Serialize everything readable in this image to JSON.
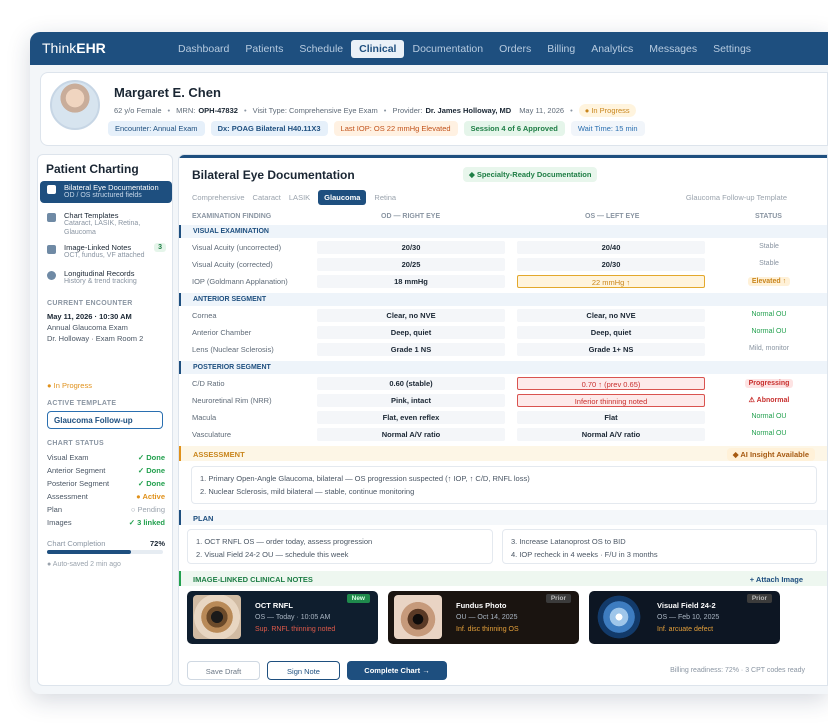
{
  "app": {
    "logo_a": "Think",
    "logo_b": "EHR"
  },
  "nav": [
    "Dashboard",
    "Patients",
    "Schedule",
    "Clinical",
    "Documentation",
    "Orders",
    "Billing",
    "Analytics",
    "Messages",
    "Settings"
  ],
  "patient": {
    "name": "Margaret E. Chen",
    "age_sex": "62 y/o Female",
    "mrn_label": "MRN:",
    "mrn": "OPH-47832",
    "visit": "Visit Type: Comprehensive Eye Exam",
    "provider_label": "Provider:",
    "provider": "Dr. James Holloway, MD",
    "date": "May 11, 2026",
    "status": "● In Progress",
    "chips": [
      "Encounter: Annual Exam",
      "Dx: POAG Bilateral H40.11X3",
      "Last IOP: OS 22 mmHg Elevated",
      "Session 4 of 6 Approved",
      "Wait Time: 15 min"
    ]
  },
  "sidebar": {
    "title": "Patient Charting",
    "items": [
      {
        "title": "Bilateral Eye Documentation",
        "sub": "OD / OS structured fields"
      },
      {
        "title": "Chart Templates",
        "sub": "Cataract, LASIK, Retina,",
        "sub2": "Glaucoma"
      },
      {
        "title": "Image-Linked Notes",
        "sub": "OCT, fundus, VF attached",
        "badge": "3"
      },
      {
        "title": "Longitudinal Records",
        "sub": "History & trend tracking"
      }
    ],
    "encounter_label": "CURRENT ENCOUNTER",
    "encounter_date": "May 11, 2026 · 10:30 AM",
    "encounter_type": "Annual Glaucoma Exam",
    "encounter_room": "Dr. Holloway · Exam Room 2",
    "encounter_status": "● In Progress",
    "template_label": "ACTIVE TEMPLATE",
    "template_value": "Glaucoma Follow-up",
    "status_label": "CHART STATUS",
    "status": [
      {
        "name": "Visual Exam",
        "value": "✓ Done",
        "kind": "ok"
      },
      {
        "name": "Anterior Segment",
        "value": "✓ Done",
        "kind": "ok"
      },
      {
        "name": "Posterior Segment",
        "value": "✓ Done",
        "kind": "ok"
      },
      {
        "name": "Assessment",
        "value": "● Active",
        "kind": "act"
      },
      {
        "name": "Plan",
        "value": "○ Pending",
        "kind": "pend"
      },
      {
        "name": "Images",
        "value": "✓ 3 linked",
        "kind": "ok"
      }
    ],
    "completion_label": "Chart Completion",
    "completion_value": "72%",
    "completion": 0.72,
    "autosave": "● Auto-saved 2 min ago"
  },
  "main": {
    "title": "Bilateral Eye Documentation",
    "specialty": "◆ Specialty-Ready Documentation",
    "tabs": [
      "Comprehensive",
      "Cataract",
      "LASIK",
      "Glaucoma",
      "Retina"
    ],
    "followup": "Glaucoma Follow-up Template",
    "columns": [
      "EXAMINATION FINDING",
      "OD — RIGHT EYE",
      "OS — LEFT EYE",
      "STATUS"
    ],
    "sections": [
      {
        "title": "VISUAL EXAMINATION",
        "rows": [
          {
            "label": "Visual Acuity (uncorrected)",
            "od": "20/30",
            "os": "20/40",
            "status": "Stable"
          },
          {
            "label": "Visual Acuity (corrected)",
            "od": "20/25",
            "os": "20/30",
            "status": "Stable"
          },
          {
            "label": "IOP (Goldmann Applanation)",
            "od": "18 mmHg",
            "os": "22 mmHg ↑",
            "status": "Elevated ↑"
          }
        ]
      },
      {
        "title": "ANTERIOR SEGMENT",
        "rows": [
          {
            "label": "Cornea",
            "od": "Clear, no NVE",
            "os": "Clear, no NVE",
            "status": "Normal OU"
          },
          {
            "label": "Anterior Chamber",
            "od": "Deep, quiet",
            "os": "Deep, quiet",
            "status": "Normal OU"
          },
          {
            "label": "Lens (Nuclear Sclerosis)",
            "od": "Grade 1 NS",
            "os": "Grade 1+ NS",
            "status": "Mild, monitor"
          }
        ]
      },
      {
        "title": "POSTERIOR SEGMENT",
        "rows": [
          {
            "label": "C/D Ratio",
            "od": "0.60 (stable)",
            "os": "0.70 ↑ (prev 0.65)",
            "status": "Progressing"
          },
          {
            "label": "Neuroretinal Rim (NRR)",
            "od": "Pink, intact",
            "os": "Inferior thinning noted",
            "status": "⚠ Abnormal"
          },
          {
            "label": "Macula",
            "od": "Flat, even reflex",
            "os": "Flat",
            "status": "Normal OU"
          },
          {
            "label": "Vasculature",
            "od": "Normal A/V ratio",
            "os": "Normal A/V ratio",
            "status": "Normal OU"
          }
        ]
      }
    ],
    "assessment_title": "ASSESSMENT",
    "ai_badge": "◆ AI Insight Available",
    "assessment": [
      "1. Primary Open-Angle Glaucoma, bilateral — OS progression suspected (↑ IOP, ↑ C/D, RNFL loss)",
      "2. Nuclear Sclerosis, mild bilateral — stable, continue monitoring"
    ],
    "plan_title": "PLAN",
    "plan_left": [
      "1. OCT RNFL OS — order today, assess progression",
      "2. Visual Field 24-2 OU — schedule this week"
    ],
    "plan_right": [
      "3. Increase Latanoprost OS to BID",
      "4. IOP recheck in 4 weeks · F/U in 3 months"
    ],
    "images_title": "IMAGE-LINKED CLINICAL NOTES",
    "attach": "+ Attach Image",
    "cards": [
      {
        "title": "OCT RNFL",
        "meta": "OS — Today · 10:05 AM",
        "finding": "Sup. RNFL thinning noted",
        "tag": "New"
      },
      {
        "title": "Fundus Photo",
        "meta": "OU — Oct 14, 2025",
        "finding": "Inf. disc thinning OS",
        "tag": "Prior"
      },
      {
        "title": "Visual Field 24-2",
        "meta": "OS — Feb 10, 2025",
        "finding": "Inf. arcuate defect",
        "tag": "Prior"
      }
    ],
    "buttons": {
      "save": "Save Draft",
      "sign": "Sign Note",
      "complete": "Complete Chart →"
    },
    "billing": "Billing readiness: 72% · 3 CPT codes ready"
  },
  "colors": {
    "primary": "#1e4f7f",
    "success": "#22a04e",
    "warning": "#e0911b",
    "danger": "#c8312f"
  }
}
